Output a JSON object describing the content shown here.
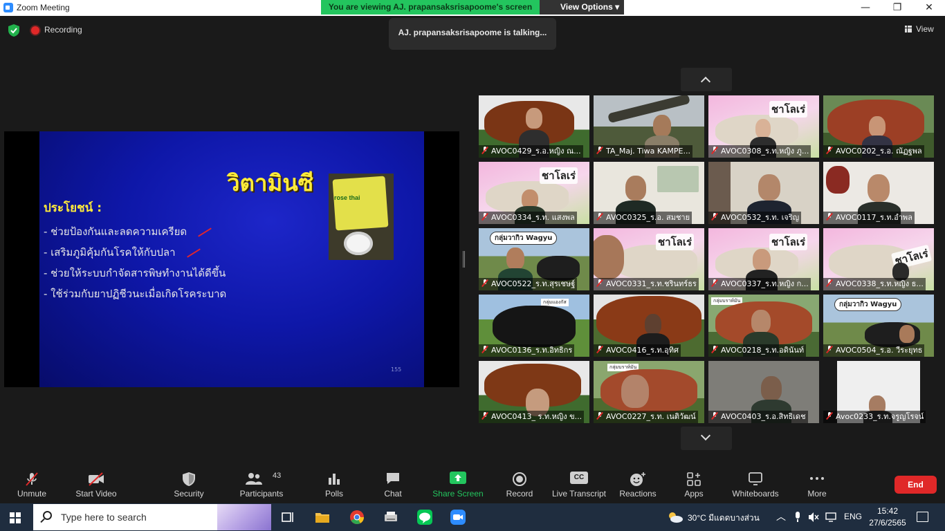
{
  "window": {
    "title": "Zoom Meeting",
    "min_glyph": "—",
    "max_glyph": "❐",
    "close_glyph": "✕"
  },
  "banner": {
    "text": "You are viewing AJ. prapansaksrisapoome's screen",
    "view_options": "View Options ▾"
  },
  "meeting": {
    "recording_label": "Recording",
    "talking_text": "AJ. prapansaksrisapoome is talking...",
    "view_label": "View"
  },
  "slide": {
    "title": "วิตามินซี",
    "subtitle": "ประโยชน์ :",
    "bullets": [
      "- ช่วยป้องกันและลดความเครียด",
      "- เสริมภูมิคุ้มกันโรคให้กับปลา",
      "- ช่วยให้ระบบกำจัดสารพิษทำงานได้ดีขึ้น",
      "- ใช้ร่วมกับยาปฏิชีวนะเมื่อเกิดโรคระบาด"
    ],
    "photo_label": "rose thai",
    "page_number": "155"
  },
  "participants": [
    {
      "name": "AVOC0429_ร.อ.หญิง ณ...",
      "sign": "",
      "bubble": "",
      "tag": ""
    },
    {
      "name": "TA_Maj. Tiwa KAMPE...",
      "sign": "",
      "bubble": "",
      "tag": ""
    },
    {
      "name": "AVOC0308_ร.ท.หญิง ภู...",
      "sign": "ชาโลเร่",
      "bubble": "",
      "tag": ""
    },
    {
      "name": "AVOC0202_ร.อ. ณัฏฐพล",
      "sign": "",
      "bubble": "",
      "tag": ""
    },
    {
      "name": "AVOC0334_ร.ท. แสงพล",
      "sign": "ชาโลเร่",
      "bubble": "",
      "tag": ""
    },
    {
      "name": "AVOC0325_ร.อ. สมชาย",
      "sign": "",
      "bubble": "",
      "tag": ""
    },
    {
      "name": "AVOC0532_ร.ท. เจริญ",
      "sign": "",
      "bubble": "",
      "tag": ""
    },
    {
      "name": "AVOC0117_ร.ท.อำพล",
      "sign": "",
      "bubble": "",
      "tag": ""
    },
    {
      "name": "AVOC0522_ร.ท.สุรเชษฐ์",
      "sign": "",
      "bubble": "กลุ่มวากิว Wagyu",
      "tag": ""
    },
    {
      "name": "AVOC0331_ร.ท.ชรินทร์ธร",
      "sign": "ชาโลเร่",
      "bubble": "",
      "tag": ""
    },
    {
      "name": "AVOC0337_ร.ท.หญิง ก...",
      "sign": "ชาโลเร่",
      "bubble": "",
      "tag": ""
    },
    {
      "name": "AVOC0338_ร.ท.หญิง ธ...",
      "sign": "ชาโลเร่",
      "bubble": "",
      "tag": ""
    },
    {
      "name": "AVOC0136_ร.ท.อิทธิกร",
      "sign": "",
      "bubble": "",
      "tag": "กลุ่มแองกัส"
    },
    {
      "name": "AVOC0416_ร.ท.อุทิศ",
      "sign": "",
      "bubble": "",
      "tag": ""
    },
    {
      "name": "AVOC0218_ร.ท.อดินันท์",
      "sign": "",
      "bubble": "",
      "tag": "กลุ่มบราห์มัน"
    },
    {
      "name": "AVOC0504_ร.อ. วีระยุทธ",
      "sign": "",
      "bubble": "กลุ่มวากิว Wagyu",
      "tag": ""
    },
    {
      "name": "AVOC0413_ ร.ท.หญิง ข...",
      "sign": "",
      "bubble": "",
      "tag": ""
    },
    {
      "name": "AVOC0227_ร.ท. เนติวัฒน์",
      "sign": "",
      "bubble": "",
      "tag": "กลุ่มบราห์มัน"
    },
    {
      "name": "AVOC0403_ร.อ.สิทธิเดช",
      "sign": "",
      "bubble": "",
      "tag": ""
    },
    {
      "name": "Avoc0233_ร.ท.จรูญโรจน์",
      "sign": "",
      "bubble": "",
      "tag": ""
    }
  ],
  "toolbar": {
    "unmute": "Unmute",
    "start_video": "Start Video",
    "security": "Security",
    "participants": "Participants",
    "participants_count": "43",
    "polls": "Polls",
    "chat": "Chat",
    "share_screen": "Share Screen",
    "record": "Record",
    "live_transcript": "Live Transcript",
    "cc": "CC",
    "reactions": "Reactions",
    "apps": "Apps",
    "whiteboards": "Whiteboards",
    "more": "More",
    "end": "End"
  },
  "taskbar": {
    "search_placeholder": "Type here to search",
    "weather": "30°C  มีแดดบางส่วน",
    "language": "ENG",
    "time": "15:42",
    "date": "27/6/2565"
  },
  "colors": {
    "share_green": "#23c55e",
    "end_red": "#e02828",
    "slide_blue": "#0e17a8",
    "slide_yellow": "#ffeb3b"
  }
}
